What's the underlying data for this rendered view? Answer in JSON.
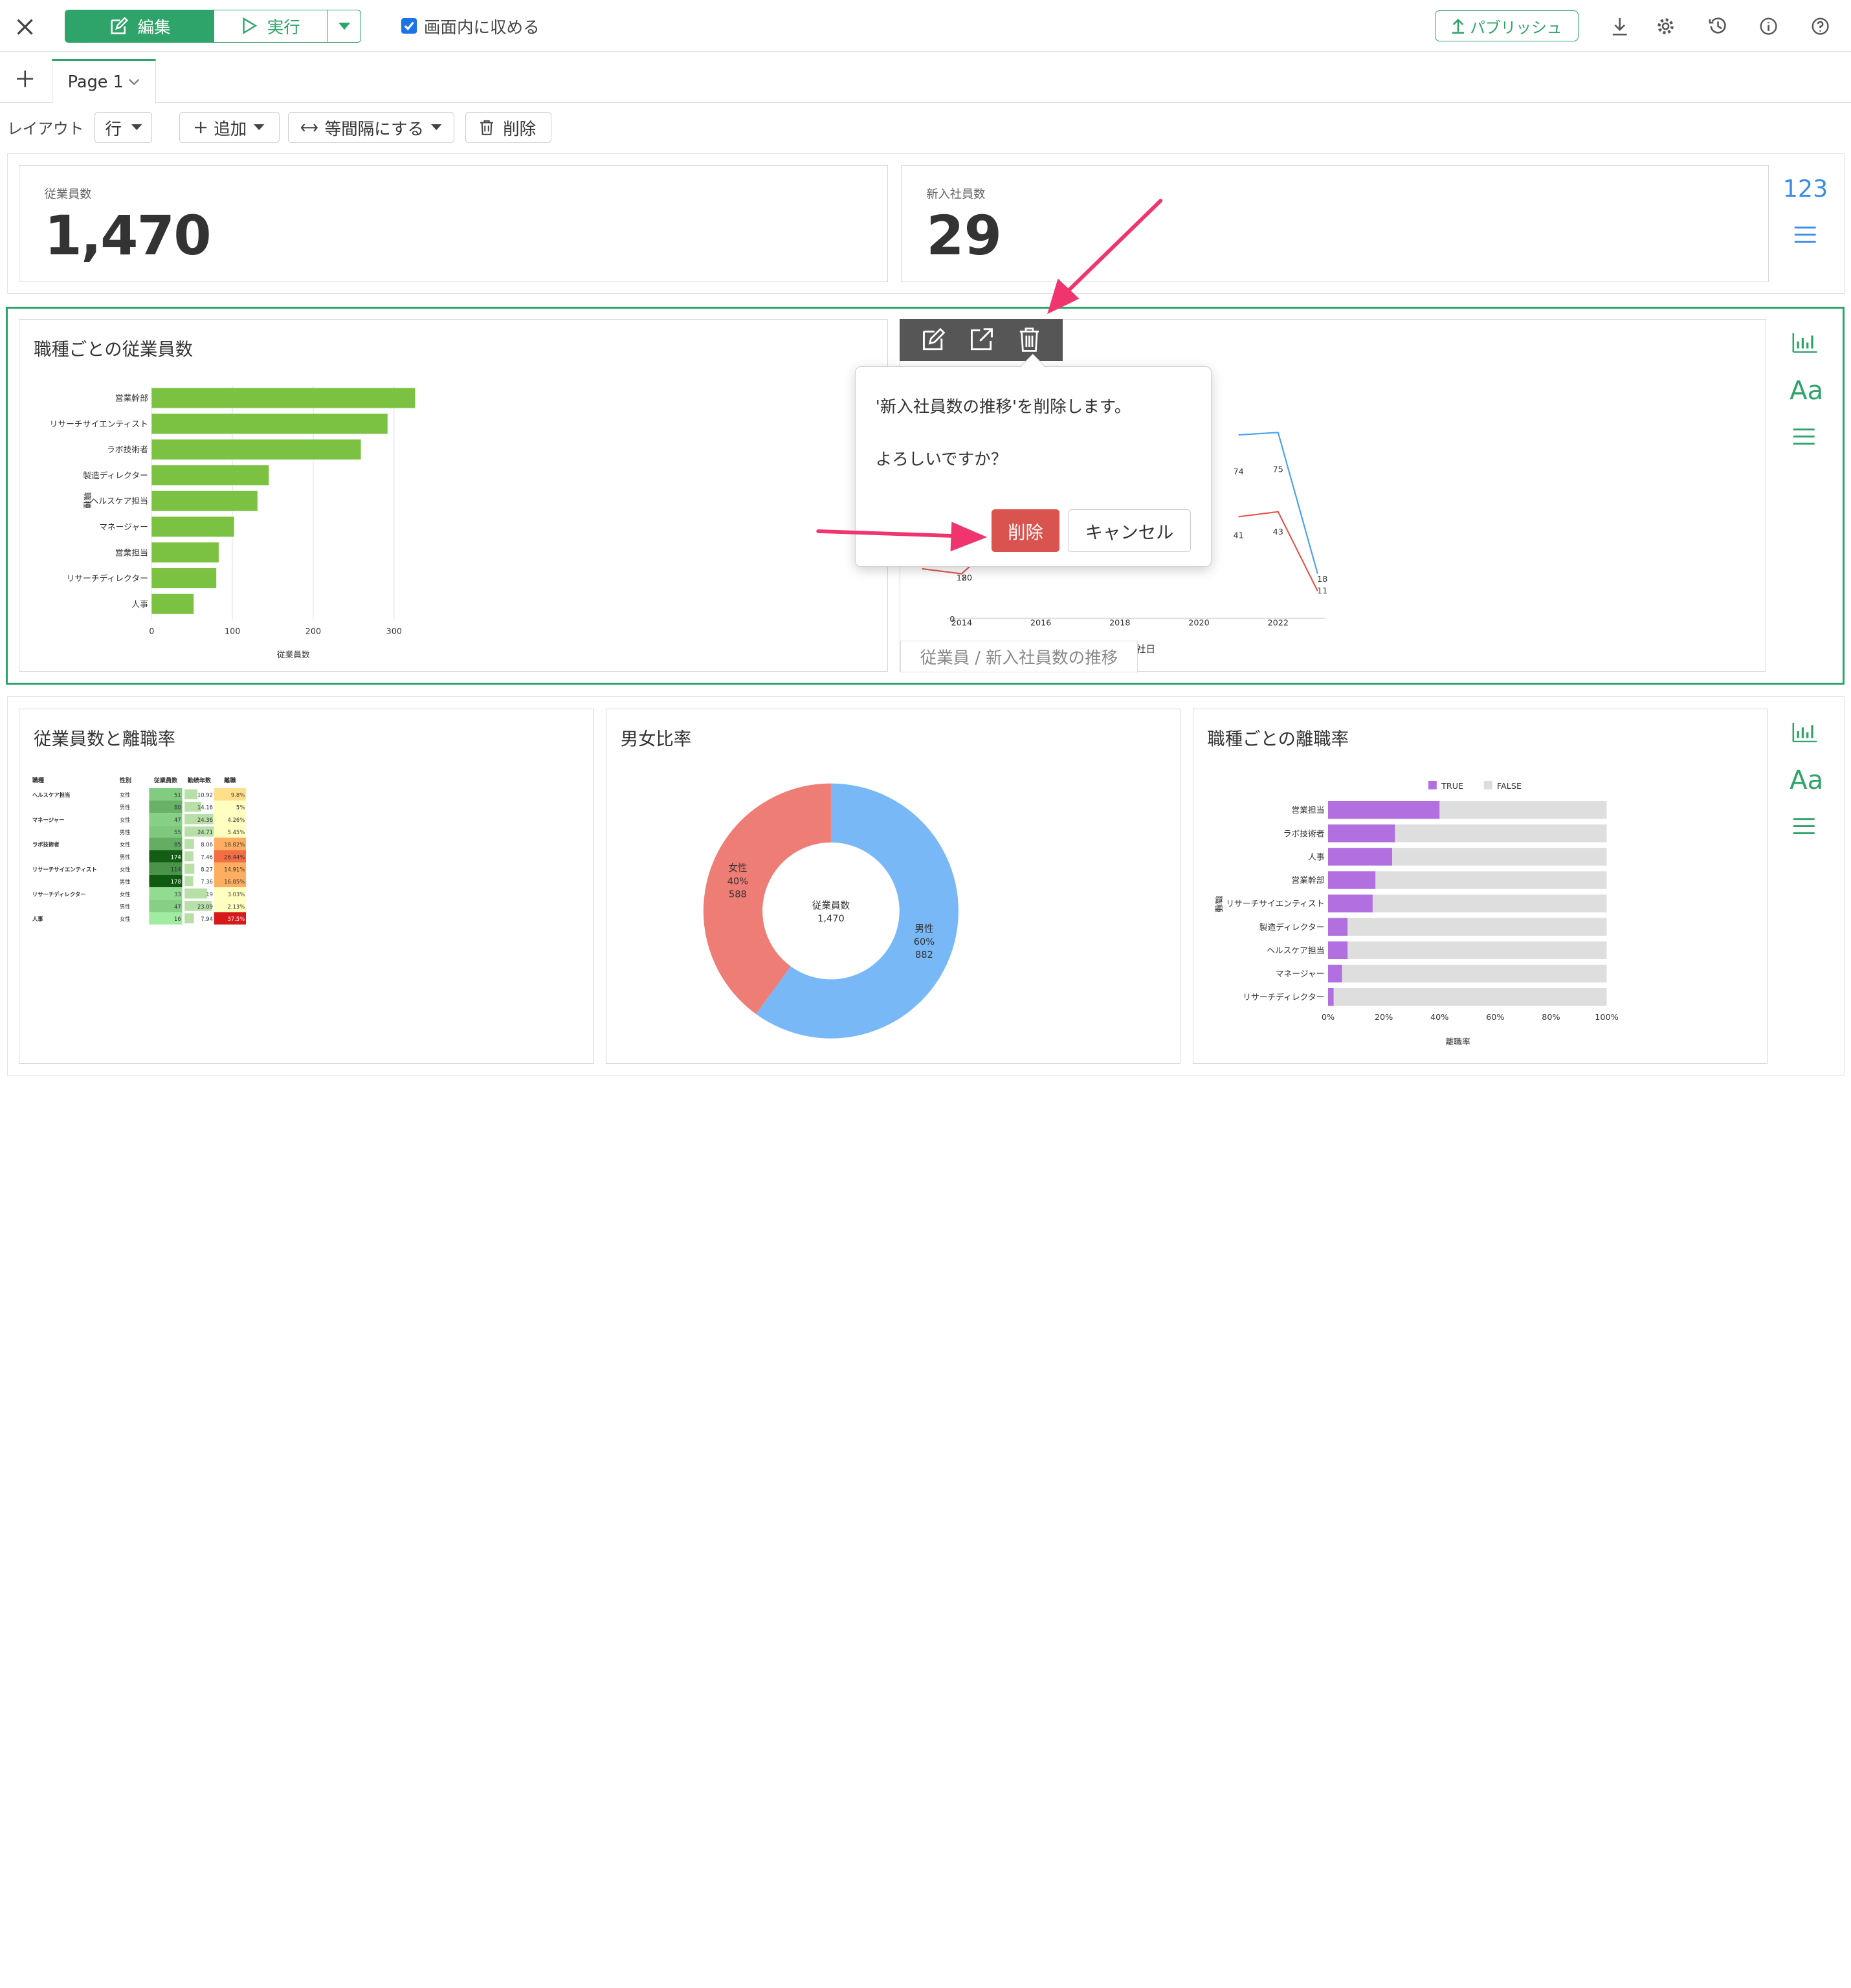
{
  "toolbar": {
    "edit_label": "編集",
    "run_label": "実行",
    "fit_label": "画面内に収める",
    "fit_checked": true,
    "publish_label": "パブリッシュ"
  },
  "tabs": {
    "page_label": "Page 1"
  },
  "layout_bar": {
    "layout_label": "レイアウト",
    "row_select": "行",
    "add_label": "追加",
    "spacing_label": "等間隔にする",
    "delete_label": "削除"
  },
  "kpis": [
    {
      "label": "従業員数",
      "value": "1,470"
    },
    {
      "label": "新入社員数",
      "value": "29"
    }
  ],
  "kpi_side": {
    "number_icon": "123"
  },
  "side_icons": {
    "text_icon": "Aa"
  },
  "bar_chart_1": {
    "title": "職種ごとの従業員数"
  },
  "line_panel": {
    "caption": "従業員 / 新入社員数の推移",
    "x_label_fragment": "社日"
  },
  "dialog": {
    "message": "'新入社員数の推移'を削除します。",
    "question": "よろしいですか？",
    "delete_button": "削除",
    "cancel_button": "キャンセル"
  },
  "table_panel": {
    "title": "従業員数と離職率"
  },
  "donut_panel": {
    "title": "男女比率"
  },
  "bar_chart_2": {
    "title": "職種ごとの離職率"
  },
  "colors": {
    "accent": "#2ea36a",
    "danger": "#d9534f",
    "arrow": "#f0346e",
    "bar_green": "#7cc242",
    "male": "#78b8f7",
    "female": "#ee7d75",
    "purple": "#b16fe0"
  },
  "chart_data": [
    {
      "type": "bar",
      "orientation": "horizontal",
      "categories": [
        "営業幹部",
        "リサーチサイエンティスト",
        "ラボ技術者",
        "製造ディレクター",
        "ヘルスケア担当",
        "マネージャー",
        "営業担当",
        "リサーチディレクター",
        "人事"
      ],
      "values": [
        326,
        292,
        259,
        145,
        131,
        102,
        83,
        80,
        52
      ],
      "xlabel": "従業員数",
      "ylabel": "職種",
      "xticks": [
        "0",
        "100",
        "200",
        "300"
      ],
      "xlim": [
        0,
        380
      ]
    },
    {
      "type": "line",
      "x": [
        2013,
        2014,
        2015,
        2016,
        2017,
        2018,
        2019,
        2020,
        2021,
        2022,
        2023
      ],
      "xticks": [
        "2014",
        "2016",
        "2018",
        "2020",
        "2022"
      ],
      "series": [
        {
          "color": "#4aa3ec",
          "values": [
            null,
            null,
            null,
            null,
            null,
            null,
            null,
            null,
            74,
            75,
            18
          ]
        },
        {
          "color": "#e4584f",
          "values": [
            20,
            18,
            null,
            null,
            null,
            null,
            null,
            null,
            41,
            43,
            11
          ]
        }
      ],
      "data_labels": [
        "20",
        "18",
        "74",
        "75",
        "41",
        "43",
        "18",
        "11"
      ],
      "ytick_label": "0"
    },
    {
      "type": "table",
      "columns": [
        "職種",
        "性別",
        "従業員数",
        "勤続年数",
        "離職"
      ],
      "rows": [
        [
          "ヘルスケア担当",
          "女性",
          "51",
          "10.92",
          "9.8%"
        ],
        [
          "",
          "男性",
          "80",
          "14.16",
          "5%"
        ],
        [
          "マネージャー",
          "女性",
          "47",
          "24.36",
          "4.26%"
        ],
        [
          "",
          "男性",
          "55",
          "24.71",
          "5.45%"
        ],
        [
          "ラボ技術者",
          "女性",
          "85",
          "8.06",
          "18.82%"
        ],
        [
          "",
          "男性",
          "174",
          "7.46",
          "26.44%"
        ],
        [
          "リサーチサイエンティスト",
          "女性",
          "114",
          "8.27",
          "14.91%"
        ],
        [
          "",
          "男性",
          "178",
          "7.36",
          "16.85%"
        ],
        [
          "リサーチディレクター",
          "女性",
          "33",
          "19",
          "3.03%"
        ],
        [
          "",
          "男性",
          "47",
          "23.09",
          "2.13%"
        ],
        [
          "人事",
          "女性",
          "16",
          "7.94",
          "37.5%"
        ]
      ]
    },
    {
      "type": "pie",
      "donut": true,
      "center_label": [
        "従業員数",
        "1,470"
      ],
      "slices": [
        {
          "label": "男性",
          "pct": "60%",
          "value": 882
        },
        {
          "label": "女性",
          "pct": "40%",
          "value": 588
        }
      ]
    },
    {
      "type": "bar",
      "orientation": "horizontal",
      "stacked": true,
      "legend": [
        "TRUE",
        "FALSE"
      ],
      "legend_position": "top",
      "categories": [
        "営業担当",
        "ラボ技術者",
        "人事",
        "営業幹部",
        "リサーチサイエンティスト",
        "製造ディレクター",
        "ヘルスケア担当",
        "マネージャー",
        "リサーチディレクター"
      ],
      "values_true": [
        40,
        24,
        23,
        17,
        16,
        7,
        7,
        5,
        2
      ],
      "xticks": [
        "0%",
        "20%",
        "40%",
        "60%",
        "80%",
        "100%"
      ],
      "xlabel": "離職率",
      "ylabel": "職種"
    }
  ]
}
